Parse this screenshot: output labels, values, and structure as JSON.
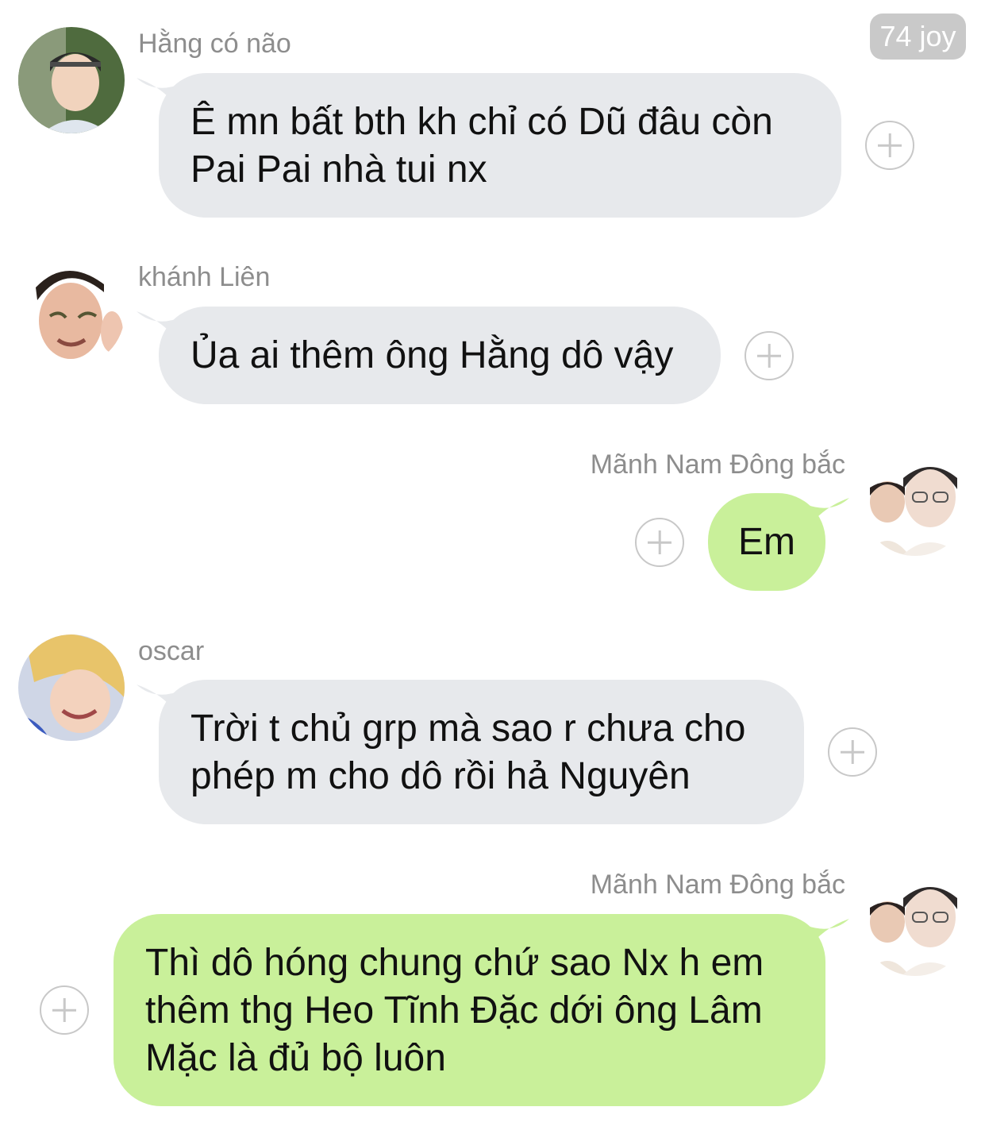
{
  "header": {
    "reaction_badge": "74 joy"
  },
  "messages": [
    {
      "sender": "Hằng có não",
      "text": "Ê mn bất bth kh chỉ có Dũ đâu còn Pai Pai nhà tui nx",
      "side": "incoming",
      "avatar": "avatar-photo-boy-headband"
    },
    {
      "sender": "khánh Liên",
      "text": "Ủa ai thêm ông Hằng dô vậy",
      "side": "incoming",
      "avatar": "avatar-photo-crying-face"
    },
    {
      "sender": "Mãnh Nam Đông bắc",
      "text": "Em",
      "side": "outgoing",
      "avatar": "avatar-photo-two-people"
    },
    {
      "sender": "oscar",
      "text": "Trời t chủ grp mà sao r chưa cho phép m cho dô rồi hả Nguyên",
      "side": "incoming",
      "avatar": "avatar-photo-blonde-smiling"
    },
    {
      "sender": "Mãnh Nam Đông bắc",
      "text": "Thì dô hóng chung chứ sao Nx h em thêm thg Heo Tĩnh Đặc dới ông Lâm Mặc là đủ bộ luôn",
      "side": "outgoing",
      "avatar": "avatar-photo-two-people"
    }
  ],
  "colors": {
    "incoming_bubble": "#e7e9ec",
    "outgoing_bubble": "#c9f09a",
    "sender_name": "#8d8d8d",
    "badge": "#c9c9c9"
  },
  "icons": {
    "reaction_button": "plus-circle-icon"
  }
}
